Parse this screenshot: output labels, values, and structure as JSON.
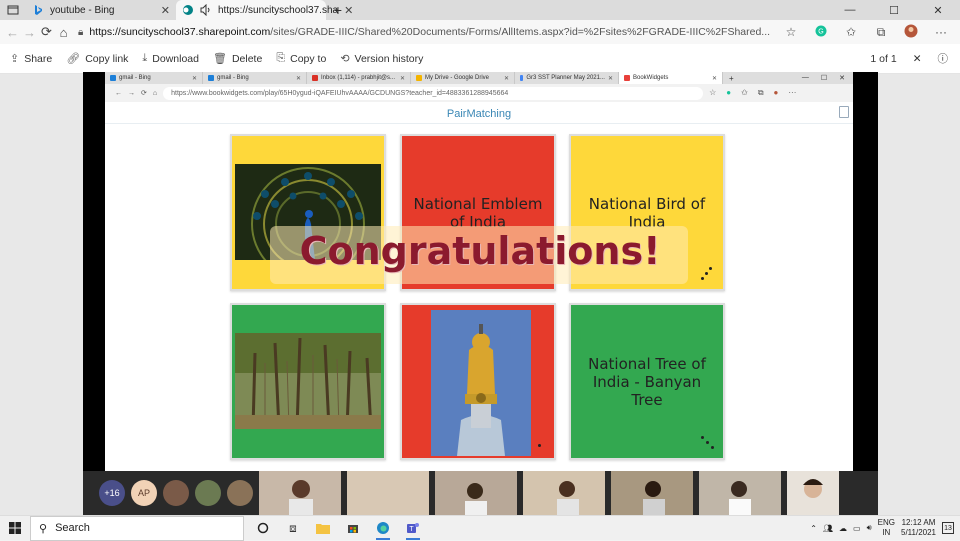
{
  "outer_browser": {
    "tabs": [
      {
        "label": "youtube - Bing",
        "icon": "bing-icon"
      },
      {
        "label": "https://suncityschool37.sha",
        "icon": "sharepoint-icon",
        "active": true
      }
    ],
    "address": {
      "host": "https://suncityschool37.sharepoint.com",
      "path": "/sites/GRADE-IIIC/Shared%20Documents/Forms/AllItems.aspx?id=%2Fsites%2FGRADE-IIIC%2FShared..."
    }
  },
  "command_bar": {
    "share": "Share",
    "copy_link": "Copy link",
    "download": "Download",
    "delete": "Delete",
    "copy_to": "Copy to",
    "version_history": "Version history",
    "page_indicator": "1 of 1"
  },
  "inner_browser": {
    "tabs": [
      {
        "label": "gmail - Bing"
      },
      {
        "label": "gmail - Bing"
      },
      {
        "label": "Inbox (1,114) - prabhjit@s..."
      },
      {
        "label": "My Drive - Google Drive"
      },
      {
        "label": "Gr3 SST Planner May 2021..."
      },
      {
        "label": "BookWidgets",
        "active": true
      }
    ],
    "url": "https://www.bookwidgets.com/play/65H0ygud-iQAFEIUhvAAAA/GCDUNGS?teacher_id=4883361288945664"
  },
  "activity": {
    "title": "PairMatching",
    "cards": [
      {
        "kind": "image",
        "image": "peacock-image",
        "color": "#fed83a"
      },
      {
        "kind": "text",
        "text": "National Emblem of India",
        "color": "#e63b2b"
      },
      {
        "kind": "text",
        "text": "National Bird of India",
        "color": "#fed83a"
      },
      {
        "kind": "image",
        "image": "banyan-tree-image",
        "color": "#33a850"
      },
      {
        "kind": "image",
        "image": "ashoka-emblem-image",
        "color": "#e63b2b"
      },
      {
        "kind": "text",
        "text": "National Tree of India - Banyan Tree",
        "color": "#33a850"
      }
    ],
    "banner": "Congratulations!"
  },
  "call": {
    "more_participants": "+16",
    "initials": "AP"
  },
  "taskbar": {
    "search_placeholder": "Search",
    "lang_top": "ENG",
    "lang_bottom": "IN",
    "time": "12:12 AM",
    "date": "5/11/2021",
    "notifications": "13"
  }
}
